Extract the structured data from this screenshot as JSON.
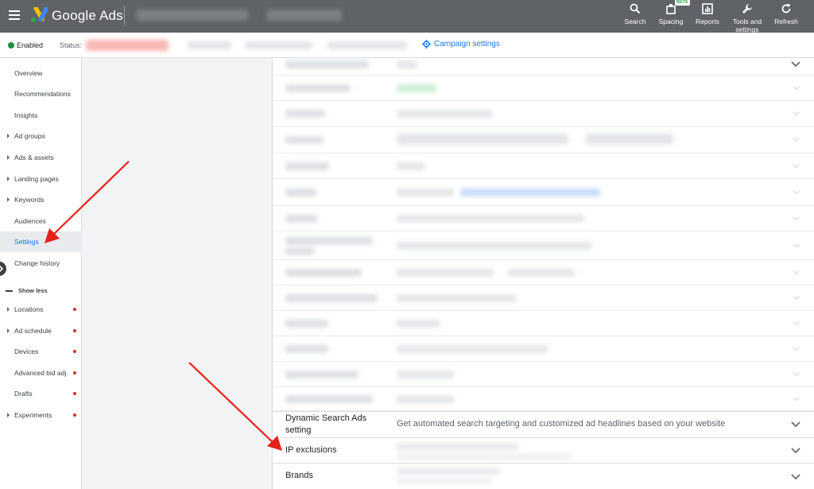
{
  "topbar": {
    "brand": "Google Ads",
    "tools": [
      {
        "label": "Search",
        "icon": "search-icon"
      },
      {
        "label": "Spacing",
        "icon": "spacing-icon",
        "badge": "BETA"
      },
      {
        "label": "Reports",
        "icon": "reports-icon"
      },
      {
        "label": "Tools and settings",
        "icon": "wrench-icon"
      },
      {
        "label": "Refresh",
        "icon": "refresh-icon"
      }
    ],
    "bg_color": "#5f6368"
  },
  "statusbar": {
    "enabled": "Enabled",
    "status_label": "Status:",
    "campaign_settings": "Campaign settings"
  },
  "sidebar": {
    "items": [
      {
        "label": "Overview"
      },
      {
        "label": "Recommendations"
      },
      {
        "label": "Insights"
      },
      {
        "label": "Ad groups"
      },
      {
        "label": "Ads & assets"
      },
      {
        "label": "Landing pages"
      },
      {
        "label": "Keywords"
      },
      {
        "label": "Audiences"
      },
      {
        "label": "Settings"
      },
      {
        "label": "Change history"
      }
    ],
    "show_less": "Show less",
    "more_items": [
      {
        "label": "Locations"
      },
      {
        "label": "Ad schedule"
      },
      {
        "label": "Devices"
      },
      {
        "label": "Advanced bid adj."
      },
      {
        "label": "Drafts"
      },
      {
        "label": "Experiments"
      }
    ],
    "active_color": "#1a73e8",
    "dot_color": "#d93025"
  },
  "settings": {
    "dsa": {
      "name": "Dynamic Search Ads setting",
      "description": "Get automated search targeting and customized ad headlines based on your website"
    },
    "ip_exclusions": {
      "name": "IP exclusions"
    },
    "brands": {
      "name": "Brands"
    }
  },
  "annotations": {
    "arrow_color": "#e8201a"
  }
}
